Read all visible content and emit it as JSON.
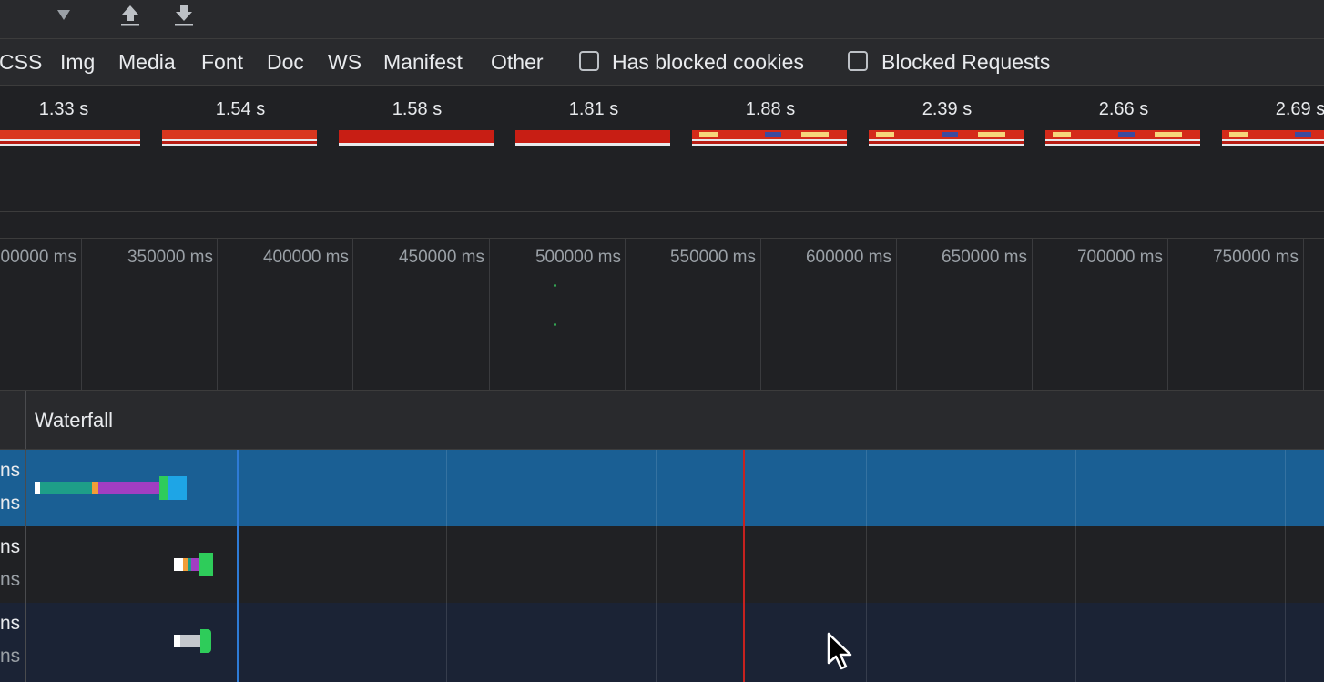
{
  "toolbar": {
    "icons": [
      "dropdown-triangle-icon",
      "import-icon",
      "export-icon"
    ]
  },
  "filters": {
    "types": [
      "CSS",
      "Img",
      "Media",
      "Font",
      "Doc",
      "WS",
      "Manifest",
      "Other"
    ],
    "has_blocked_cookies": "Has blocked cookies",
    "blocked_requests": "Blocked Requests"
  },
  "filmstrip": {
    "times": [
      "1.33 s",
      "1.54 s",
      "1.58 s",
      "1.81 s",
      "1.88 s",
      "2.39 s",
      "2.66 s",
      "2.69 s"
    ]
  },
  "overview": {
    "ticks": [
      "00000 ms",
      "350000 ms",
      "400000 ms",
      "450000 ms",
      "500000 ms",
      "550000 ms",
      "600000 ms",
      "650000 ms",
      "700000 ms",
      "750000 ms"
    ]
  },
  "waterfall": {
    "title": "Waterfall",
    "rows": [
      {
        "line1": "ns",
        "line2": "ns"
      },
      {
        "line1": "ns",
        "line2": "ns"
      },
      {
        "line1": "ns",
        "line2": "ns"
      }
    ]
  },
  "colors": {
    "selected_row": "#1a5f94",
    "dom_content_loaded_line": "#2e7bd6",
    "load_line": "#c5221f",
    "bar_waiting": "#1e9e88",
    "bar_ssl": "#a13ec2",
    "bar_download": "#1ea5e6",
    "bar_receive": "#2ecc5a"
  }
}
